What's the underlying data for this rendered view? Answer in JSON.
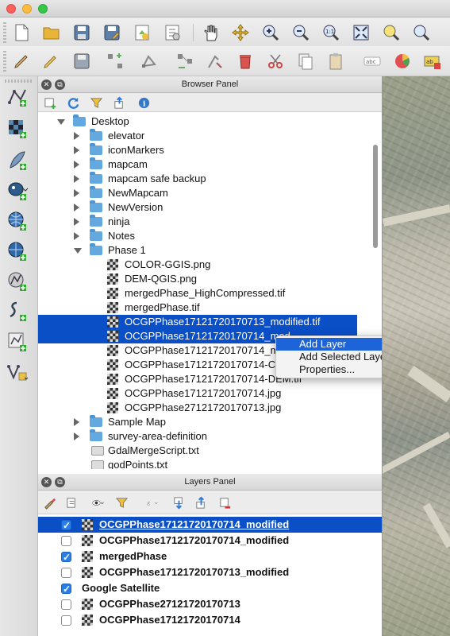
{
  "window": {
    "controls": [
      "close",
      "minimize",
      "zoom"
    ]
  },
  "toolbar_top": {
    "icons": [
      "new-project-icon",
      "open-project-icon",
      "save-project-icon",
      "save-as-icon",
      "new-print-composer-icon",
      "composer-manager-icon",
      "pan-icon",
      "pan-to-selection-icon",
      "zoom-in-icon",
      "zoom-out-icon",
      "zoom-actual-size-icon",
      "zoom-full-icon",
      "zoom-to-selection-icon",
      "zoom-to-layer-icon"
    ]
  },
  "toolbar_digitize": {
    "icons": [
      "current-edits-icon",
      "toggle-editing-icon",
      "save-layer-edits-icon",
      "add-feature-icon",
      "move-feature-icon",
      "node-tool-icon",
      "delete-selected-icon",
      "cut-features-icon",
      "copy-features-icon",
      "paste-features-icon",
      "label-icon",
      "diagram-icon",
      "label-pin-icon"
    ]
  },
  "left_toolbar": {
    "icons": [
      "add-vector-layer-icon",
      "add-raster-layer-icon",
      "add-spatialite-layer-icon",
      "add-postgis-layer-icon",
      "add-wms-layer-icon",
      "add-wcs-layer-icon",
      "add-wfs-layer-icon",
      "add-delimited-text-icon",
      "new-shapefile-icon",
      "new-temporary-layer-icon"
    ]
  },
  "browser_panel": {
    "title": "Browser Panel",
    "tool_icons": [
      "add-selected-icon",
      "refresh-icon",
      "filter-icon",
      "collapse-all-icon",
      "properties-icon"
    ],
    "items": [
      {
        "label": "Desktop",
        "type": "folder",
        "depth": 1,
        "expand": "down"
      },
      {
        "label": "elevator",
        "type": "folder",
        "depth": 2,
        "expand": "right"
      },
      {
        "label": "iconMarkers",
        "type": "folder",
        "depth": 2,
        "expand": "right"
      },
      {
        "label": "mapcam",
        "type": "folder",
        "depth": 2,
        "expand": "right"
      },
      {
        "label": "mapcam safe backup",
        "type": "folder",
        "depth": 2,
        "expand": "right"
      },
      {
        "label": "NewMapcam",
        "type": "folder",
        "depth": 2,
        "expand": "right"
      },
      {
        "label": "NewVersion",
        "type": "folder",
        "depth": 2,
        "expand": "right"
      },
      {
        "label": "ninja",
        "type": "folder",
        "depth": 2,
        "expand": "right"
      },
      {
        "label": "Notes",
        "type": "folder",
        "depth": 2,
        "expand": "right"
      },
      {
        "label": "Phase 1",
        "type": "folder",
        "depth": 2,
        "expand": "down"
      },
      {
        "label": "COLOR-GGIS.png",
        "type": "raster",
        "depth": 3
      },
      {
        "label": "DEM-QGIS.png",
        "type": "raster",
        "depth": 3
      },
      {
        "label": "mergedPhase_HighCompressed.tif",
        "type": "raster",
        "depth": 3
      },
      {
        "label": "mergedPhase.tif",
        "type": "raster",
        "depth": 3
      },
      {
        "label": "OCGPPhase17121720170713_modified.tif",
        "type": "raster",
        "depth": 3,
        "selected": true
      },
      {
        "label": "OCGPPhase17121720170714_mod",
        "type": "raster",
        "depth": 3,
        "selected": true
      },
      {
        "label": "OCGPPhase17121720170714_mo",
        "type": "raster",
        "depth": 3
      },
      {
        "label": "OCGPPhase17121720170714-COL",
        "type": "raster",
        "depth": 3
      },
      {
        "label": "OCGPPhase17121720170714-DEM.tif",
        "type": "raster",
        "depth": 3
      },
      {
        "label": "OCGPPhase17121720170714.jpg",
        "type": "raster",
        "depth": 3
      },
      {
        "label": "OCGPPhase27121720170713.jpg",
        "type": "raster",
        "depth": 3
      },
      {
        "label": "Sample Map",
        "type": "folder",
        "depth": 2,
        "expand": "right"
      },
      {
        "label": "survey-area-definition",
        "type": "folder",
        "depth": 2,
        "expand": "right"
      },
      {
        "label": "GdalMergeScript.txt",
        "type": "file",
        "depth": 2
      },
      {
        "label": "godPoints.txt",
        "type": "file",
        "depth": 2
      }
    ]
  },
  "context_menu": {
    "items": [
      {
        "label": "Add Layer",
        "highlighted": true
      },
      {
        "label": "Add Selected Layers",
        "highlighted": false
      },
      {
        "label": "Properties...",
        "highlighted": false
      }
    ]
  },
  "layers_panel": {
    "title": "Layers Panel",
    "tool_icons": [
      "layer-styling-icon",
      "add-group-icon",
      "manage-visibility-icon",
      "filter-legend-icon",
      "filter-expression-icon",
      "expand-all-icon",
      "collapse-all-icon",
      "remove-layer-icon"
    ],
    "items": [
      {
        "label": "OCGPPhase17121720170714_modified",
        "checked": true,
        "raster": true,
        "selected": true,
        "underlined": true
      },
      {
        "label": "OCGPPhase17121720170714_modified",
        "checked": false,
        "raster": true,
        "selected": false
      },
      {
        "label": "mergedPhase",
        "checked": true,
        "raster": true,
        "selected": false
      },
      {
        "label": "OCGPPhase17121720170713_modified",
        "checked": false,
        "raster": true,
        "selected": false
      },
      {
        "label": "Google Satellite",
        "checked": true,
        "raster": false,
        "selected": false
      },
      {
        "label": "OCGPPhase27121720170713",
        "checked": false,
        "raster": true,
        "selected": false
      },
      {
        "label": "OCGPPhase17121720170714",
        "checked": false,
        "raster": true,
        "selected": false
      }
    ]
  },
  "map_canvas": {
    "content": "satellite-imagery"
  }
}
